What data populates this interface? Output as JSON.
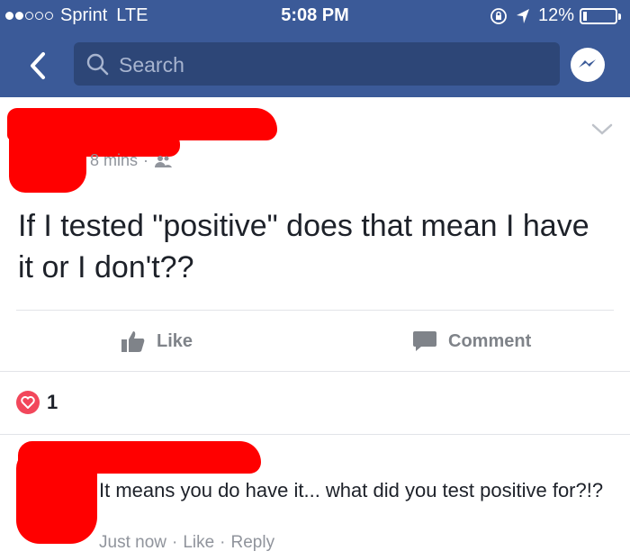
{
  "status": {
    "carrier": "Sprint",
    "network": "LTE",
    "time": "5:08 PM",
    "battery": "12%",
    "signal_bars": 2,
    "signal_total": 5,
    "battery_level": 0.12,
    "icons": [
      "orientation-lock-icon",
      "location-arrow-icon"
    ]
  },
  "nav": {
    "search_placeholder": "Search",
    "back_icon": "back-chevron-icon",
    "messenger_icon": "messenger-icon",
    "colors": {
      "bar": "#3b5a98",
      "search": "#2d4677"
    }
  },
  "post": {
    "time_ago": "8 mins",
    "audience_icon": "friends-icon",
    "text": "If I tested \"positive\" does that mean I have it or I don't??",
    "actions": {
      "like": "Like",
      "comment": "Comment"
    },
    "reaction_count": "1",
    "reaction_icon": "love-reaction-icon"
  },
  "comment": {
    "text": "It means you do have it... what did you test positive for?!?",
    "time": "Just now",
    "like": "Like",
    "reply": "Reply"
  },
  "colors": {
    "redaction": "#ff0000",
    "accent": "#3b5a98",
    "muted": "#90949c"
  }
}
